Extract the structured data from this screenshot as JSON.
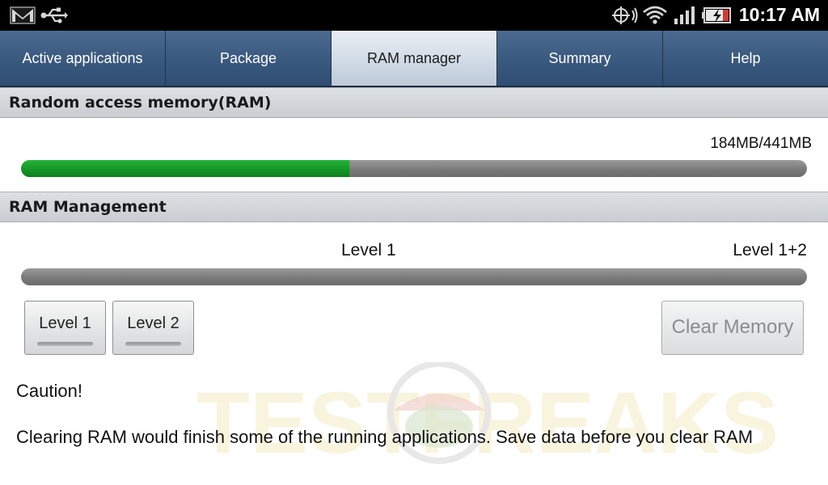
{
  "status_bar": {
    "time": "10:17 AM",
    "icons": [
      "gmail-icon",
      "usb-icon",
      "gps-icon",
      "wifi-icon",
      "signal-icon",
      "battery-charging-icon"
    ]
  },
  "tabs": [
    {
      "label": "Active applications",
      "active": false
    },
    {
      "label": "Package",
      "active": false
    },
    {
      "label": "RAM manager",
      "active": true
    },
    {
      "label": "Summary",
      "active": false
    },
    {
      "label": "Help",
      "active": false
    }
  ],
  "ram": {
    "header": "Random access memory(RAM)",
    "usage_text": "184MB/441MB",
    "used_mb": 184,
    "total_mb": 441
  },
  "management": {
    "header": "RAM Management",
    "level1_label": "Level 1",
    "level12_label": "Level 1+2",
    "buttons": {
      "level1": "Level 1",
      "level2": "Level 2",
      "clear": "Clear Memory"
    }
  },
  "caution": {
    "title": "Caution!",
    "text": "Clearing RAM would finish some of the running applications. Save data before you clear RAM"
  },
  "watermark": {
    "text": "TESTFREAKS"
  },
  "colors": {
    "accent_green": "#139625",
    "tab_blue": "#3b5a80",
    "status_bar": "#000000"
  }
}
